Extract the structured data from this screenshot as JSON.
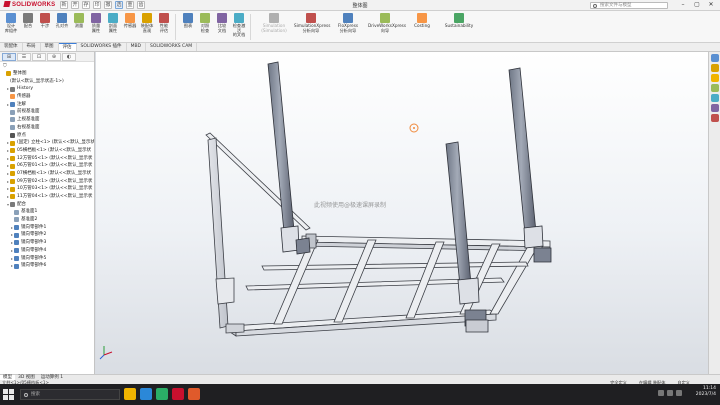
{
  "titlebar": {
    "app_name": "SOLIDWORKS",
    "document_title": "整体图",
    "search_placeholder": "搜索文件与模型",
    "quick_access": [
      "新",
      "开",
      "存",
      "印",
      "撤",
      "选",
      "重",
      "齿"
    ],
    "window_controls": [
      "–",
      "▢",
      "✕"
    ]
  },
  "ribbon": {
    "buttons": [
      {
        "label": "设计\n库组件",
        "icon": "design-library-icon",
        "color": "#5a8fd1"
      },
      {
        "label": "配合",
        "icon": "mate-icon",
        "color": "#7a7a7a"
      },
      {
        "label": "干涉",
        "icon": "interference-icon",
        "color": "#c0504d"
      },
      {
        "label": "孔对齐",
        "icon": "hole-align-icon",
        "color": "#4f81bd"
      },
      {
        "label": "测量",
        "icon": "measure-icon",
        "color": "#9bbb59"
      },
      {
        "label": "质量\n属性",
        "icon": "mass-properties-icon",
        "color": "#8064a2"
      },
      {
        "label": "剖面\n属性",
        "icon": "section-properties-icon",
        "color": "#4bacc6"
      },
      {
        "label": "传感器",
        "icon": "sensor-icon",
        "color": "#f79646"
      },
      {
        "label": "装配体\n直观",
        "icon": "assembly-visual-icon",
        "color": "#d9a100"
      },
      {
        "label": "性能\n评估",
        "icon": "performance-icon",
        "color": "#c0504d"
      },
      {
        "label": "图表",
        "icon": "chart-icon",
        "color": "#4f81bd"
      },
      {
        "label": "对照\n检查",
        "icon": "compare-icon",
        "color": "#9bbb59"
      },
      {
        "label": "比较\n文档",
        "icon": "compare-documents-icon",
        "color": "#8064a2"
      },
      {
        "label": "检查激活\n的文档",
        "icon": "check-active-document-icon",
        "color": "#4bacc6"
      }
    ],
    "wide_buttons": [
      {
        "label": "Simulation\n(Simulation)",
        "icon": "simulation-icon",
        "color": "#b0b0b0",
        "disabled": true
      },
      {
        "label": "SimulationXpress\n分析向导",
        "icon": "simulationxpress-icon",
        "color": "#c0504d",
        "disabled": false
      },
      {
        "label": "FloXpress\n分析向导",
        "icon": "floxpress-icon",
        "color": "#4f81bd",
        "disabled": false
      },
      {
        "label": "DriveWorksXpress\n向导",
        "icon": "driveworksxpress-icon",
        "color": "#9bbb59",
        "disabled": false
      },
      {
        "label": "Costing",
        "icon": "costing-icon",
        "color": "#f79646",
        "disabled": false
      },
      {
        "label": "Sustainability",
        "icon": "sustainability-icon",
        "color": "#4aa564",
        "disabled": false
      }
    ]
  },
  "tabs": [
    "装配体",
    "布局",
    "草图",
    "评估",
    "SOLIDWORKS 插件",
    "MBD",
    "SOLIDWORKS CAM"
  ],
  "active_tab_index": 3,
  "feature_tree": {
    "panel_tabs": [
      "⊞",
      "☰",
      "⊡",
      "⊕",
      "◐"
    ],
    "filter_icon": "filter-icon",
    "nodes": [
      {
        "label": "整体图",
        "indent": 0,
        "icon_color": "#d9a100",
        "expander": ""
      },
      {
        "label": "(默认<默认_显示状态-1>)",
        "indent": 1,
        "icon_color": "",
        "expander": ""
      },
      {
        "label": "History",
        "indent": 1,
        "icon_color": "#7a7a7a",
        "expander": "▸"
      },
      {
        "label": "传感器",
        "indent": 1,
        "icon_color": "#f79646",
        "expander": ""
      },
      {
        "label": "注解",
        "indent": 1,
        "icon_color": "#4f81bd",
        "expander": "▸"
      },
      {
        "label": "前视基准面",
        "indent": 1,
        "icon_color": "#8aa0b8",
        "expander": ""
      },
      {
        "label": "上视基准面",
        "indent": 1,
        "icon_color": "#8aa0b8",
        "expander": ""
      },
      {
        "label": "右视基准面",
        "indent": 1,
        "icon_color": "#8aa0b8",
        "expander": ""
      },
      {
        "label": "原点",
        "indent": 1,
        "icon_color": "#555555",
        "expander": ""
      },
      {
        "label": "(固定) 立柱<1> (默认<<默认_显示状",
        "indent": 1,
        "icon_color": "#d9a100",
        "expander": "▸"
      },
      {
        "label": "05横档板<1> (默认<<默认_显示状",
        "indent": 1,
        "icon_color": "#d9a100",
        "expander": "▸"
      },
      {
        "label": "12方管05<1> (默认<<默认_显示状",
        "indent": 1,
        "icon_color": "#d9a100",
        "expander": "▸"
      },
      {
        "label": "06方管01<1> (默认<<默认_显示状",
        "indent": 1,
        "icon_color": "#d9a100",
        "expander": "▸"
      },
      {
        "label": "07横档板<1> (默认<<默认_显示状",
        "indent": 1,
        "icon_color": "#d9a100",
        "expander": "▸"
      },
      {
        "label": "09方管02<1> (默认<<默认_显示状",
        "indent": 1,
        "icon_color": "#d9a100",
        "expander": "▸"
      },
      {
        "label": "10方管03<1> (默认<<默认_显示状",
        "indent": 1,
        "icon_color": "#d9a100",
        "expander": "▸"
      },
      {
        "label": "11方管04<1> (默认<<默认_显示状",
        "indent": 1,
        "icon_color": "#d9a100",
        "expander": "▸"
      },
      {
        "label": "配合",
        "indent": 1,
        "icon_color": "#7a7a7a",
        "expander": "▾"
      },
      {
        "label": "基准面1",
        "indent": 2,
        "icon_color": "#8aa0b8",
        "expander": ""
      },
      {
        "label": "基准面2",
        "indent": 2,
        "icon_color": "#8aa0b8",
        "expander": ""
      },
      {
        "label": "镜向零部件1",
        "indent": 2,
        "icon_color": "#4f81bd",
        "expander": "▸"
      },
      {
        "label": "镜向零部件2",
        "indent": 2,
        "icon_color": "#4f81bd",
        "expander": "▸"
      },
      {
        "label": "镜向零部件3",
        "indent": 2,
        "icon_color": "#4f81bd",
        "expander": "▸"
      },
      {
        "label": "镜向零部件4",
        "indent": 2,
        "icon_color": "#4f81bd",
        "expander": "▸"
      },
      {
        "label": "镜向零部件5",
        "indent": 2,
        "icon_color": "#4f81bd",
        "expander": "▸"
      },
      {
        "label": "镜向零部件6",
        "indent": 2,
        "icon_color": "#4f81bd",
        "expander": "▸"
      }
    ]
  },
  "viewport": {
    "watermark": "此视频使用@极速课屏录制",
    "accent_color": "#3b7dd8"
  },
  "right_bar_icons": [
    {
      "name": "home-icon",
      "color": "#5a8fd1"
    },
    {
      "name": "design-library-icon",
      "color": "#d9a100"
    },
    {
      "name": "file-explorer-icon",
      "color": "#f0b400"
    },
    {
      "name": "view-palette-icon",
      "color": "#9bbb59"
    },
    {
      "name": "appearances-icon",
      "color": "#4bacc6"
    },
    {
      "name": "custom-properties-icon",
      "color": "#8064a2"
    },
    {
      "name": "solidworks-forum-icon",
      "color": "#c0504d"
    }
  ],
  "status": {
    "bottom_tabs": [
      "模型",
      "3D 视图",
      "运动算例 1"
    ],
    "active_bottom_tab": 0,
    "left_text": "立柱<1>/05横档板<1>",
    "right_items": [
      "完全定义",
      "在编辑 装配体",
      "自定义"
    ]
  },
  "taskbar": {
    "search_placeholder": "搜索",
    "apps": [
      {
        "name": "file-explorer-app-icon",
        "color": "#f0b400"
      },
      {
        "name": "browser-app-icon",
        "color": "#2b88d8"
      },
      {
        "name": "wechat-app-icon",
        "color": "#2aae67"
      },
      {
        "name": "solidworks-app-icon",
        "color": "#c8102e"
      },
      {
        "name": "media-app-icon",
        "color": "#e05a2b"
      }
    ],
    "time": "11:14",
    "date": "2023/7/4"
  }
}
